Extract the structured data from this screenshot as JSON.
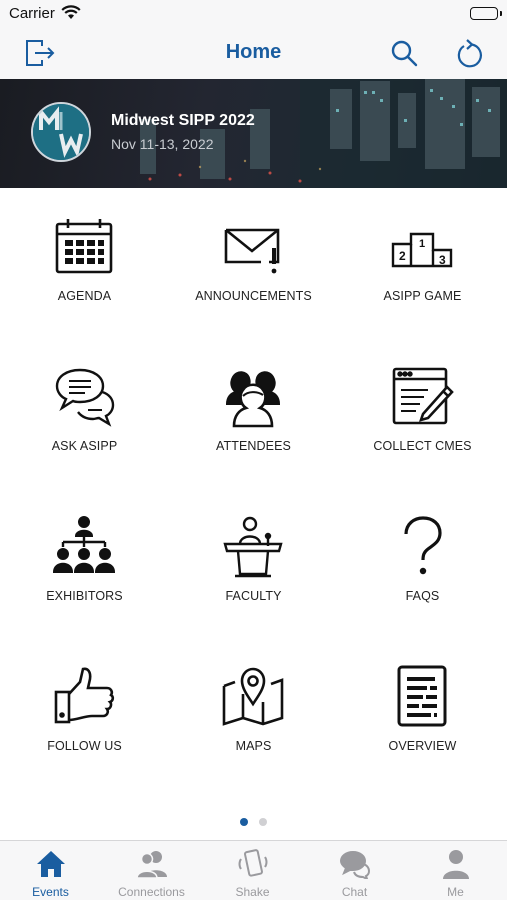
{
  "status_bar": {
    "carrier": "Carrier"
  },
  "nav": {
    "title": "Home"
  },
  "event": {
    "name": "Midwest SIPP 2022",
    "dates": "Nov 11-13, 2022"
  },
  "menu": [
    {
      "label": "AGENDA",
      "icon": "calendar-icon"
    },
    {
      "label": "ANNOUNCEMENTS",
      "icon": "envelope-alert-icon"
    },
    {
      "label": "ASIPP GAME",
      "icon": "podium-icon"
    },
    {
      "label": "ASK ASIPP",
      "icon": "speech-bubbles-icon"
    },
    {
      "label": "ATTENDEES",
      "icon": "people-icon"
    },
    {
      "label": "COLLECT CMES",
      "icon": "form-pencil-icon"
    },
    {
      "label": "EXHIBITORS",
      "icon": "org-chart-icon"
    },
    {
      "label": "FACULTY",
      "icon": "lectern-icon"
    },
    {
      "label": "FAQS",
      "icon": "question-mark-icon"
    },
    {
      "label": "FOLLOW US",
      "icon": "thumbs-up-icon"
    },
    {
      "label": "MAPS",
      "icon": "map-pin-icon"
    },
    {
      "label": "OVERVIEW",
      "icon": "document-icon"
    }
  ],
  "pagination": {
    "current": 1,
    "total": 2
  },
  "tabs": [
    {
      "label": "Events",
      "icon": "house-icon",
      "active": true
    },
    {
      "label": "Connections",
      "icon": "two-people-icon",
      "active": false
    },
    {
      "label": "Shake",
      "icon": "phone-shake-icon",
      "active": false
    },
    {
      "label": "Chat",
      "icon": "chat-bubbles-icon",
      "active": false
    },
    {
      "label": "Me",
      "icon": "person-icon",
      "active": false
    }
  ],
  "colors": {
    "accent": "#1a5da0",
    "tab_inactive": "#9a9a9e",
    "dot_inactive": "#d0d0d3"
  }
}
